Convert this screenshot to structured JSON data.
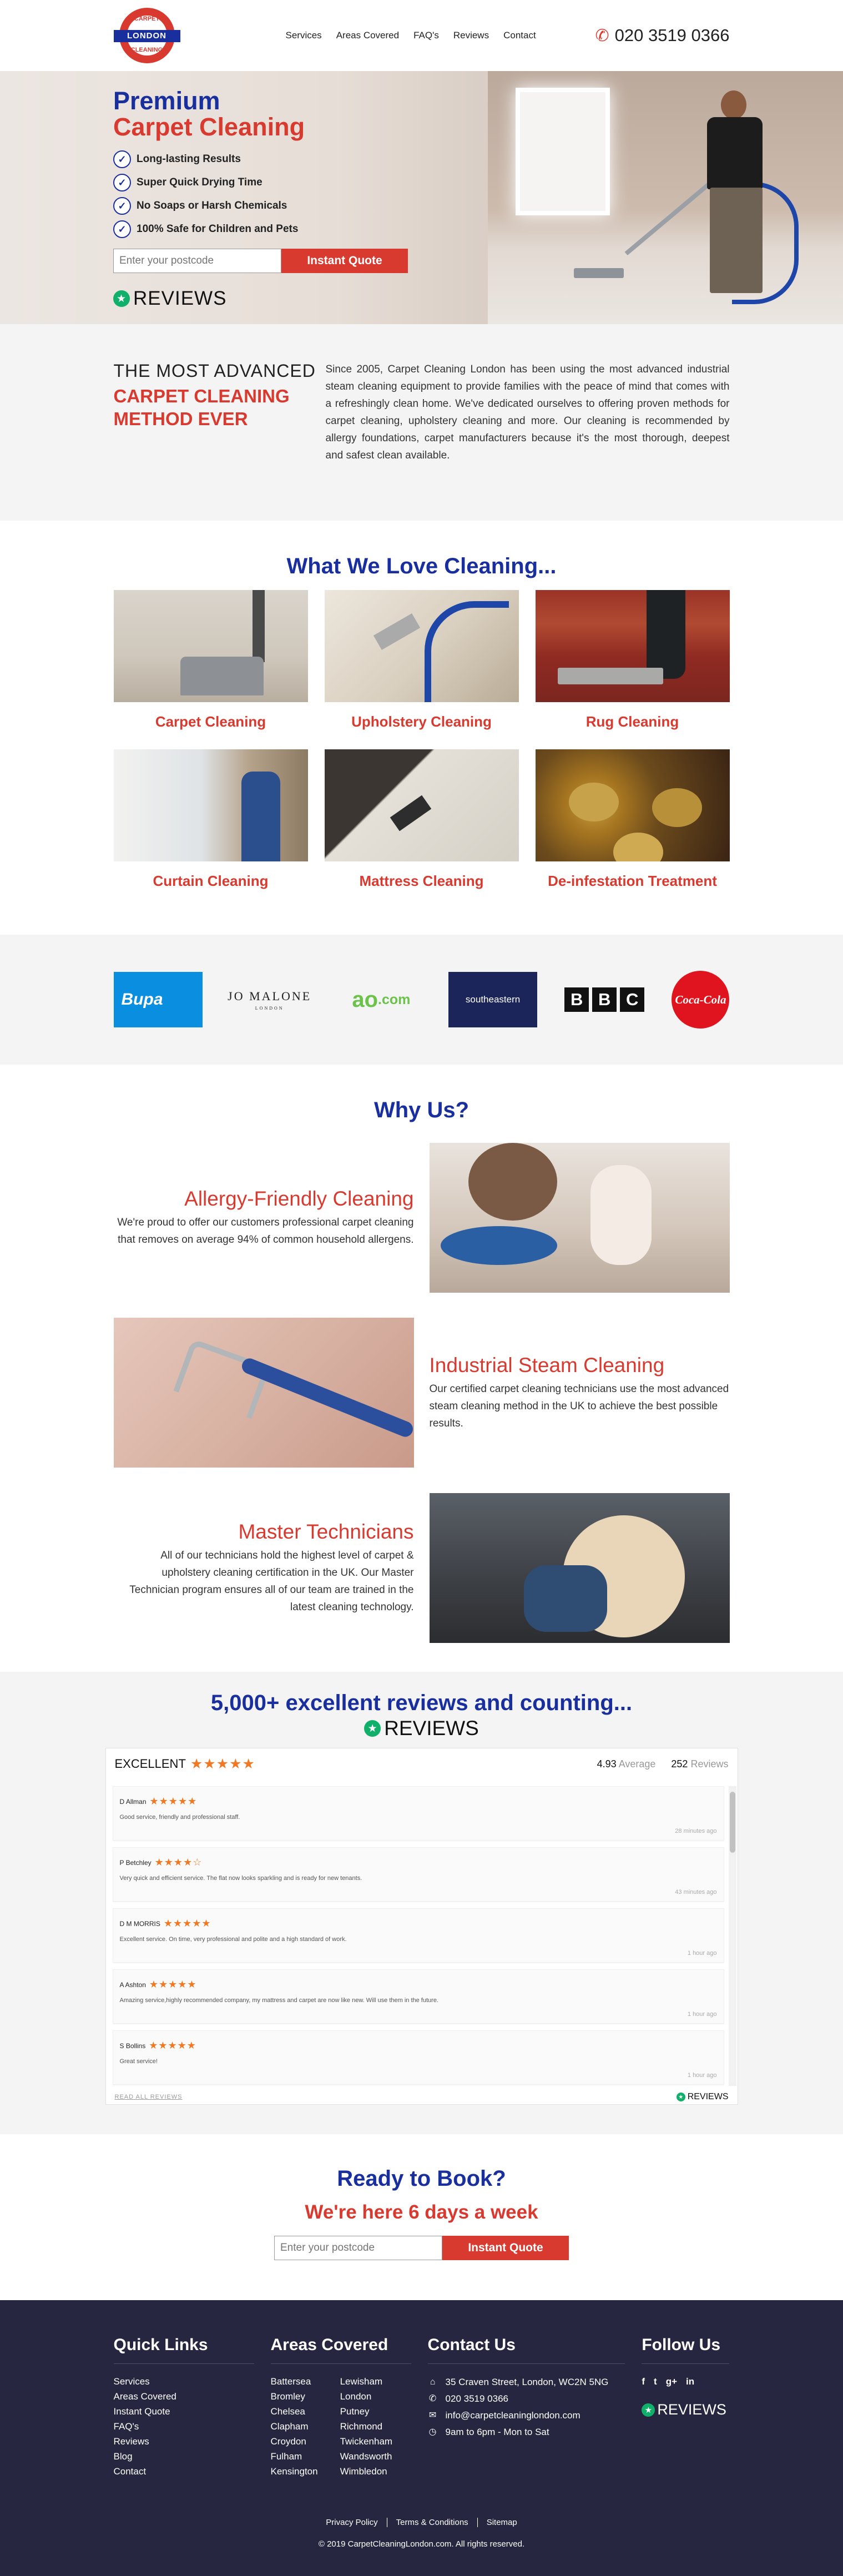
{
  "header": {
    "logo": {
      "top": "CARPET",
      "middle": "LONDON",
      "bottom": "CLEANING"
    },
    "nav": [
      "Services",
      "Areas Covered",
      "FAQ's",
      "Reviews",
      "Contact"
    ],
    "phone": "020 3519 0366"
  },
  "hero": {
    "title_line1": "Premium",
    "title_line2": "Carpet Cleaning",
    "benefits": [
      "Long-lasting Results",
      "Super Quick Drying Time",
      "No Soaps or Harsh Chemicals",
      "100% Safe for Children and Pets"
    ],
    "postcode_placeholder": "Enter your postcode",
    "quote_button": "Instant Quote",
    "reviews_label": "REVIEWS"
  },
  "advanced": {
    "small_heading": "THE MOST ADVANCED",
    "big_heading_line1": "CARPET CLEANING",
    "big_heading_line2": "METHOD EVER",
    "body": "Since 2005, Carpet Cleaning London has been using the most advanced industrial steam cleaning equipment to provide families with the peace of mind that comes with a refreshingly clean home. We've dedicated ourselves to offering proven methods for carpet cleaning, upholstery cleaning and more. Our cleaning is recommended by allergy foundations, carpet manufacturers because it's the most thorough, deepest and safest clean available."
  },
  "love": {
    "title": "What We Love Cleaning...",
    "items": [
      {
        "name": "Carpet Cleaning",
        "img": "carpet"
      },
      {
        "name": "Upholstery Cleaning",
        "img": "upholstery"
      },
      {
        "name": "Rug Cleaning",
        "img": "rug"
      },
      {
        "name": "Curtain Cleaning",
        "img": "curtain"
      },
      {
        "name": "Mattress Cleaning",
        "img": "mattress"
      },
      {
        "name": "De-infestation Treatment",
        "img": "infestation"
      }
    ]
  },
  "brands": {
    "bupa": "Bupa",
    "jomalone": "JO MALONE",
    "jomalone_sub": "LONDON",
    "ao": "ao",
    "ao_suffix": ".com",
    "southeastern": "southeastern",
    "bbc": [
      "B",
      "B",
      "C"
    ],
    "coke": "Coca-Cola"
  },
  "why": {
    "title": "Why Us?",
    "features": [
      {
        "title": "Allergy-Friendly Cleaning",
        "text": "We're proud to offer our customers professional carpet cleaning that removes on average 94% of common household allergens."
      },
      {
        "title": "Industrial Steam Cleaning",
        "text": "Our certified carpet cleaning technicians use the most advanced steam cleaning method in the UK to achieve the best possible results."
      },
      {
        "title": "Master Technicians",
        "text": "All of our technicians hold the highest level of carpet & upholstery cleaning certification in the UK. Our Master Technician program ensures all of our team are trained in the latest cleaning technology."
      }
    ]
  },
  "reviews": {
    "title": "5,000+ excellent reviews and counting...",
    "logo_label": "REVIEWS",
    "widget": {
      "excellent": "EXCELLENT",
      "average_value": "4.93",
      "average_label": "Average",
      "count_value": "252",
      "count_label": "Reviews",
      "read_all": "READ ALL REVIEWS",
      "brand": "REVIEWS",
      "items": [
        {
          "name": "D Allman",
          "stars": "★★★★★",
          "text": "Good service, friendly and professional staff.",
          "ago": "28 minutes ago"
        },
        {
          "name": "P Betchley",
          "stars": "★★★★☆",
          "text": "Very quick and efficient service. The flat now looks sparkling and is ready for new tenants.",
          "ago": "43 minutes ago"
        },
        {
          "name": "D M MORRIS",
          "stars": "★★★★★",
          "text": "Excellent service. On time, very professional and polite and a high standard of work.",
          "ago": "1 hour ago"
        },
        {
          "name": "A Ashton",
          "stars": "★★★★★",
          "text": "Amazing service,highly recommended company, my mattress and carpet are now like new. Will use them in the future.",
          "ago": "1 hour ago"
        },
        {
          "name": "S Bollins",
          "stars": "★★★★★",
          "text": "Great service!",
          "ago": "1 hour ago"
        }
      ]
    }
  },
  "book": {
    "title": "Ready to Book?",
    "subtitle": "We're here 6 days a week",
    "postcode_placeholder": "Enter your postcode",
    "quote_button": "Instant Quote"
  },
  "footer": {
    "quick_links_title": "Quick Links",
    "quick_links": [
      "Services",
      "Areas Covered",
      "Instant Quote",
      "FAQ's",
      "Reviews",
      "Blog",
      "Contact"
    ],
    "areas_title": "Areas Covered",
    "areas_col1": [
      "Battersea",
      "Bromley",
      "Chelsea",
      "Clapham",
      "Croydon",
      "Fulham",
      "Kensington"
    ],
    "areas_col2": [
      "Lewisham",
      "London",
      "Putney",
      "Richmond",
      "Twickenham",
      "Wandsworth",
      "Wimbledon"
    ],
    "contact_title": "Contact Us",
    "address": "35 Craven Street, London, WC2N 5NG",
    "phone": "020 3519 0366",
    "email": "info@carpetcleaninglondon.com",
    "hours": "9am to 6pm - Mon to Sat",
    "follow_title": "Follow Us",
    "social": [
      "f",
      "t",
      "g+",
      "in"
    ],
    "reviews_label": "REVIEWS",
    "links": [
      "Privacy Policy",
      "Terms & Conditions",
      "Sitemap"
    ],
    "copyright": "© 2019 CarpetCleaningLondon.com. All rights reserved."
  }
}
